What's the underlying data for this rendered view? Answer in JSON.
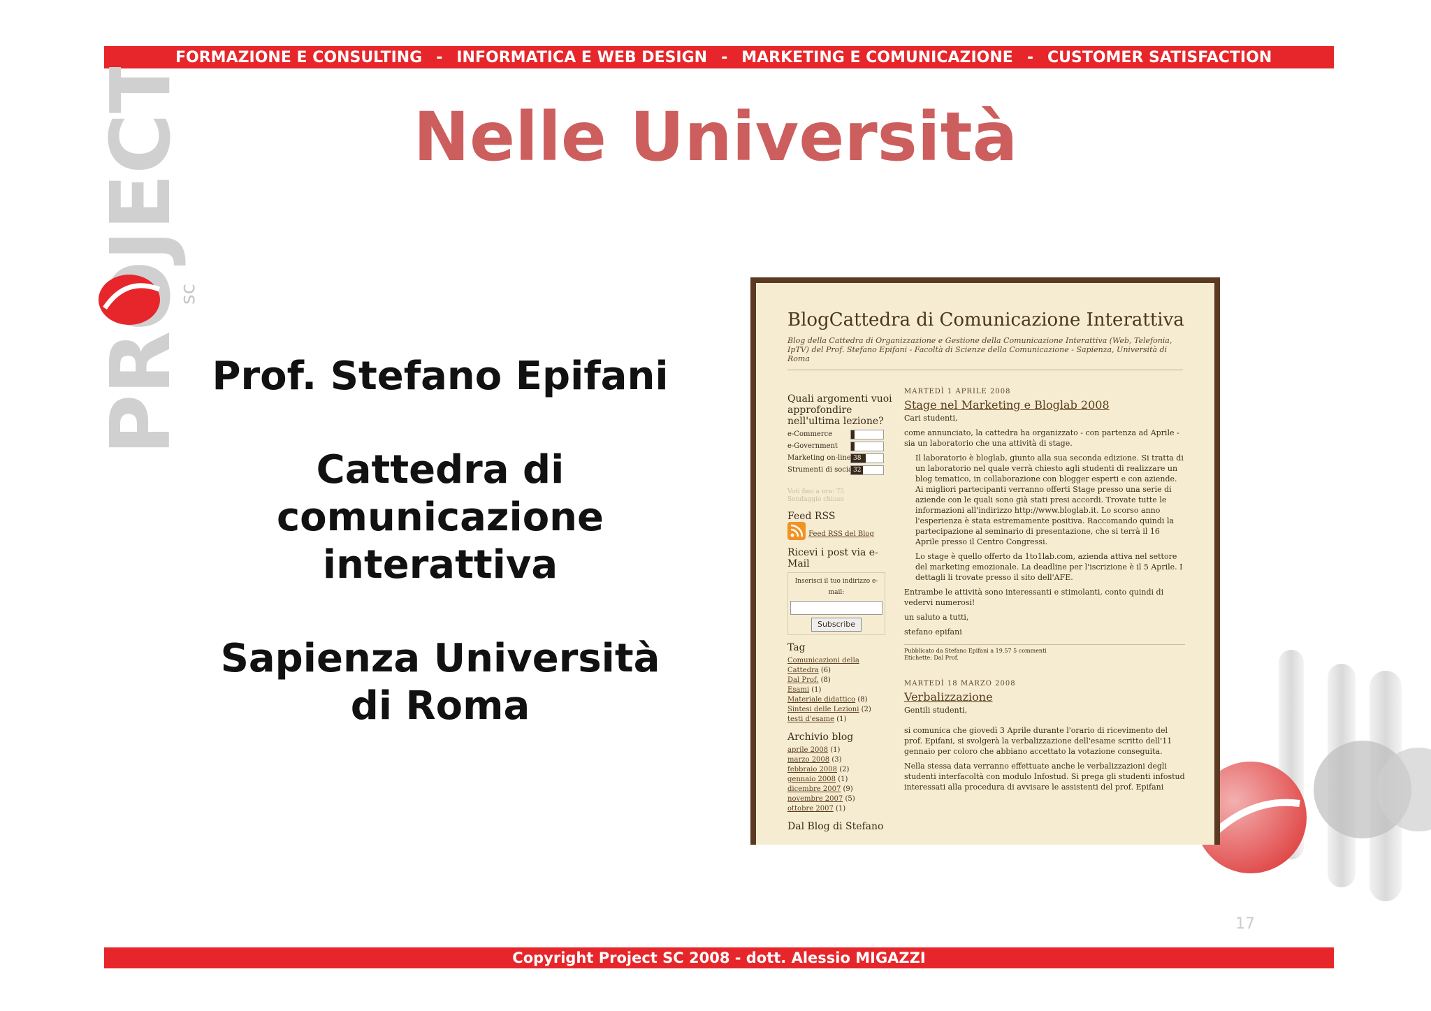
{
  "topbar": {
    "items": [
      "FORMAZIONE E CONSULTING",
      "INFORMATICA E WEB DESIGN",
      "MARKETING E COMUNICAZIONE",
      "CUSTOMER SATISFACTION"
    ],
    "separator": "-"
  },
  "logo": {
    "main": "PROJECT",
    "sub": "sc"
  },
  "title": "Nelle Università",
  "left": {
    "line1": "Prof. Stefano Epifani",
    "line2": "Cattedra di",
    "line3": "comunicazione",
    "line4": "interattiva",
    "line5": "Sapienza Università",
    "line6": "di Roma"
  },
  "blog": {
    "title": "BlogCattedra di Comunicazione Interattiva",
    "subtitle": "Blog della Cattedra di Organizzazione e Gestione della Comunicazione Interattiva (Web, Telefonia, IpTV) del Prof. Stefano Epifani - Facoltà di Scienze della Comunicazione - Sapienza, Università di Roma",
    "poll": {
      "question": "Quali argomenti vuoi approfondire nell'ultima lezione?",
      "options": [
        {
          "label": "e-Commerce",
          "value": "",
          "fill": 0.1
        },
        {
          "label": "e-Government",
          "value": "",
          "fill": 0.1
        },
        {
          "label": "Marketing on-line",
          "value": "38",
          "fill": 0.45
        },
        {
          "label": "Strumenti di social m",
          "value": "32",
          "fill": 0.38
        }
      ],
      "footer1": "Voti fino a ora: 75",
      "footer2": "Sondaggio chiuso"
    },
    "feed": {
      "heading": "Feed RSS",
      "link": "Feed RSS del Blog"
    },
    "mail": {
      "heading": "Ricevi i post via e-Mail",
      "prompt": "Inserisci il tuo indirizzo e-mail:",
      "button": "Subscribe"
    },
    "tag": {
      "heading": "Tag",
      "items": [
        {
          "label": "Comunicazioni della Cattedra",
          "count": "(6)"
        },
        {
          "label": "Dal Prof.",
          "count": "(8)"
        },
        {
          "label": "Esami",
          "count": "(1)"
        },
        {
          "label": "Materiale didattico",
          "count": "(8)"
        },
        {
          "label": "Sintesi delle Lezioni",
          "count": "(2)"
        },
        {
          "label": "testi d'esame",
          "count": "(1)"
        }
      ]
    },
    "archive": {
      "heading": "Archivio blog",
      "items": [
        {
          "label": "aprile 2008",
          "count": "(1)"
        },
        {
          "label": "marzo 2008",
          "count": "(3)"
        },
        {
          "label": "febbraio 2008",
          "count": "(2)"
        },
        {
          "label": "gennaio 2008",
          "count": "(1)"
        },
        {
          "label": "dicembre 2007",
          "count": "(9)"
        },
        {
          "label": "novembre 2007",
          "count": "(5)"
        },
        {
          "label": "ottobre 2007",
          "count": "(1)"
        }
      ]
    },
    "dal_blog": "Dal Blog di Stefano",
    "post1": {
      "date": "MARTEDÌ 1 APRILE 2008",
      "title": "Stage nel Marketing e Bloglab 2008",
      "greeting": "Cari studenti,",
      "p1": "come annunciato, la cattedra ha organizzato - con partenza ad Aprile - sia un laboratorio che una attività di stage.",
      "p2": "Il laboratorio è bloglab, giunto alla sua seconda edizione. Si tratta di un laboratorio nel quale verrà chiesto agli studenti di realizzare un blog tematico, in collaborazione con blogger esperti e con aziende. Ai migliori partecipanti verranno offerti Stage presso una serie di aziende con le quali sono già stati presi accordi. Trovate tutte le informazioni all'indirizzo http://www.bloglab.it. Lo scorso anno l'esperienza è stata estremamente positiva. Raccomando quindi la partecipazione al seminario di presentazione, che si terrà il 16 Aprile presso il Centro Congressi.",
      "p3": "Lo stage è quello offerto da 1to1lab.com, azienda attiva nel settore del marketing emozionale. La deadline per l'iscrizione è il 5 Aprile. I dettagli li trovate presso il sito dell'AFE.",
      "p4": "Entrambe le attività sono interessanti e stimolanti, conto quindi di vedervi numerosi!",
      "p5": "un saluto a tutti,",
      "p6": "stefano epifani",
      "meta1": "Pubblicato da Stefano Epifani a 19.57   5 commenti",
      "meta2": "Etichette: Dal Prof."
    },
    "post2": {
      "date": "MARTEDÌ 18 MARZO 2008",
      "title": "Verbalizzazione",
      "greeting": "Gentili studenti,",
      "p1": "si comunica che giovedì 3 Aprile durante l'orario di ricevimento del prof. Epifani, si svolgerà la verbalizzazione dell'esame scritto dell'11 gennaio per coloro che abbiano accettato la votazione conseguita.",
      "p2": "Nella stessa data verranno effettuate anche le verbalizzazioni degli studenti interfacoltà con modulo Infostud. Si prega gli studenti infostud interessati alla procedura di avvisare le assistenti del prof. Epifani"
    }
  },
  "page_number": "17",
  "footer": "Copyright Project SC 2008 - dott. Alessio MIGAZZI",
  "colors": {
    "red_bar": "#e6262a",
    "title": "#cd5e5e",
    "logo_grey": "#d0d0d0"
  }
}
